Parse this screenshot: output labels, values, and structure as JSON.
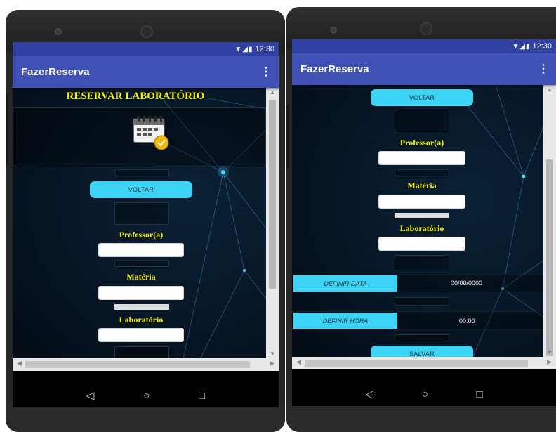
{
  "status": {
    "time": "12:30",
    "icons": "▼◢▮"
  },
  "app": {
    "title": "FazerReserva",
    "menu_icon": "⋮"
  },
  "left": {
    "heading": "RESERVAR LABORATÓRIO",
    "calendar_icon": "calendar-check-icon",
    "back_button": "VOLTAR",
    "professor_label": "Professor(a)",
    "materia_label": "Matéria",
    "laboratorio_label": "Laboratório",
    "professor_value": "",
    "materia_value": "",
    "laboratorio_value": ""
  },
  "right": {
    "back_button": "VOLTAR",
    "professor_label": "Professor(a)",
    "materia_label": "Matéria",
    "laboratorio_label": "Laboratório",
    "define_date_button": "DEFINIR DATA",
    "date_value": "00/00/0000",
    "define_time_button": "DEFINIR HORA",
    "time_value": "00:00",
    "save_button": "SALVAR"
  },
  "nav": {
    "back": "◁",
    "home": "○",
    "recents": "□"
  },
  "colors": {
    "accent": "#3cd3f4",
    "appbar": "#3f51b5",
    "label": "#f2f200"
  }
}
